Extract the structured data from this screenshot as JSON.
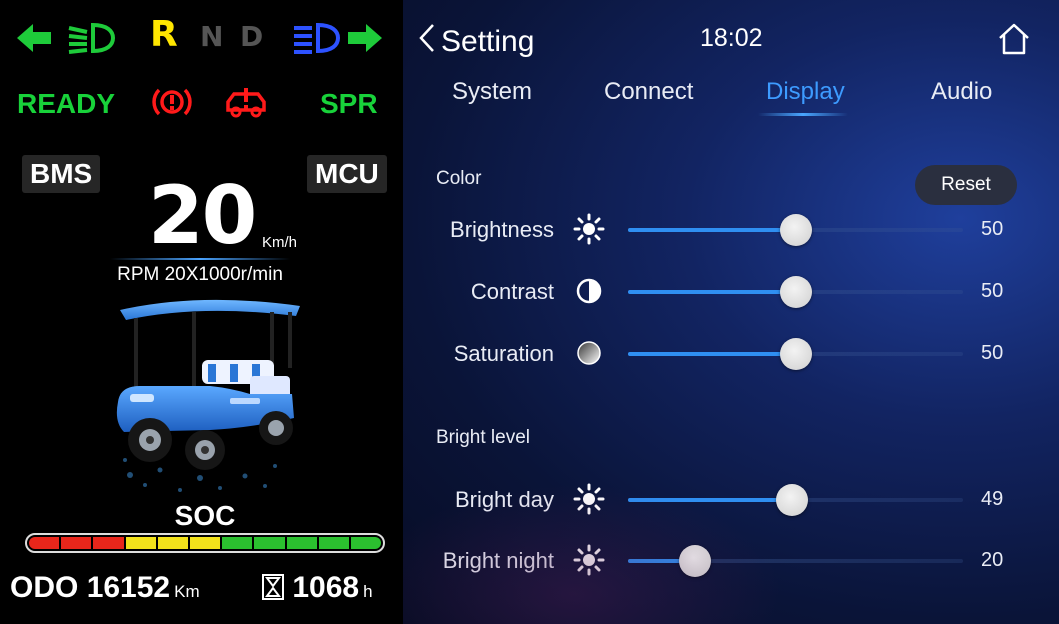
{
  "cluster": {
    "indicators": {
      "left_turn_color": "#1ecb3a",
      "low_beam_color": "#1ecb3a",
      "high_beam_color": "#2d52ff",
      "right_turn_color": "#1ecb3a"
    },
    "gears": [
      {
        "label": "R",
        "color": "#ffe600"
      },
      {
        "label": "N",
        "color": "#555555"
      },
      {
        "label": "D",
        "color": "#555555"
      }
    ],
    "status": {
      "ready": "READY",
      "ready_color": "#18d23a",
      "spr": "SPR",
      "spr_color": "#18d23a",
      "warning_color": "#ff1a1a"
    },
    "bms_label": "BMS",
    "mcu_label": "MCU",
    "speed": "20",
    "speed_unit": "Km/h",
    "rpm_text": "RPM 20X1000r/min",
    "soc_label": "SOC",
    "soc_segments": [
      "#e8261b",
      "#e8261b",
      "#e8261b",
      "#f2e21b",
      "#f2e21b",
      "#f2e21b",
      "#2bbf2f",
      "#2bbf2f",
      "#2bbf2f",
      "#2bbf2f",
      "#2bbf2f"
    ],
    "odo_label": "ODO",
    "odo_value": "16152",
    "odo_unit": "Km",
    "hours_value": "1068",
    "hours_unit": "h"
  },
  "settings": {
    "back_label": "Setting",
    "time": "18:02",
    "tabs": [
      {
        "label": "System"
      },
      {
        "label": "Connect"
      },
      {
        "label": "Display",
        "active": true
      },
      {
        "label": "Audio"
      }
    ],
    "color_section": "Color",
    "reset_label": "Reset",
    "color_sliders": [
      {
        "label": "Brightness",
        "icon": "sun-icon",
        "value": 50
      },
      {
        "label": "Contrast",
        "icon": "contrast-icon",
        "value": 50
      },
      {
        "label": "Saturation",
        "icon": "saturation-icon",
        "value": 50
      }
    ],
    "bright_section": "Bright level",
    "bright_sliders": [
      {
        "label": "Bright day",
        "icon": "sun-icon",
        "value": 49
      },
      {
        "label": "Bright night",
        "icon": "sun-icon",
        "value": 20
      }
    ],
    "accent_color": "#2f8ff2"
  }
}
